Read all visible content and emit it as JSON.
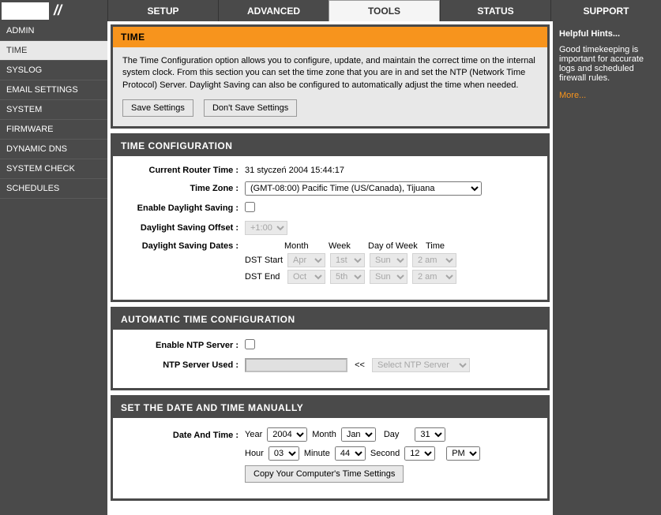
{
  "nav": {
    "setup": "SETUP",
    "advanced": "ADVANCED",
    "tools": "TOOLS",
    "status": "STATUS",
    "support": "SUPPORT"
  },
  "sidebar": {
    "admin": "ADMIN",
    "time": "TIME",
    "syslog": "SYSLOG",
    "email": "EMAIL SETTINGS",
    "system": "SYSTEM",
    "firmware": "FIRMWARE",
    "ddns": "DYNAMIC DNS",
    "syscheck": "SYSTEM CHECK",
    "schedules": "SCHEDULES"
  },
  "hints": {
    "title": "Helpful Hints...",
    "text": "Good timekeeping is important for accurate logs and scheduled firewall rules.",
    "more": "More..."
  },
  "time_panel": {
    "title": "TIME",
    "desc": "The Time Configuration option allows you to configure, update, and maintain the correct time on the internal system clock. From this section you can set the time zone that you are in and set the NTP (Network Time Protocol) Server. Daylight Saving can also be configured to automatically adjust the time when needed.",
    "save": "Save Settings",
    "dont": "Don't Save Settings"
  },
  "cfg": {
    "title": "TIME CONFIGURATION",
    "cur_label": "Current Router Time :",
    "cur_val": "31 styczeń 2004 15:44:17",
    "tz_label": "Time Zone :",
    "tz_val": "(GMT-08:00) Pacific Time (US/Canada), Tijuana",
    "dst_en_label": "Enable Daylight Saving :",
    "dst_off_label": "Daylight Saving Offset :",
    "dst_off_val": "+1:00",
    "dst_dates_label": "Daylight Saving Dates :",
    "col_month": "Month",
    "col_week": "Week",
    "col_dow": "Day of Week",
    "col_time": "Time",
    "dst_start": "DST Start",
    "dst_end": "DST End",
    "s_month": "Apr",
    "s_week": "1st",
    "s_dow": "Sun",
    "s_time": "2 am",
    "e_month": "Oct",
    "e_week": "5th",
    "e_dow": "Sun",
    "e_time": "2 am"
  },
  "ntp": {
    "title": "AUTOMATIC TIME CONFIGURATION",
    "en_label": "Enable NTP Server :",
    "used_label": "NTP Server Used :",
    "arrow": "<<",
    "select": "Select NTP Server"
  },
  "manual": {
    "title": "SET THE DATE AND TIME MANUALLY",
    "label": "Date And Time :",
    "year_l": "Year",
    "year": "2004",
    "month_l": "Month",
    "month": "Jan",
    "day_l": "Day",
    "day": "31",
    "hour_l": "Hour",
    "hour": "03",
    "min_l": "Minute",
    "min": "44",
    "sec_l": "Second",
    "sec": "12",
    "ampm": "PM",
    "copy": "Copy Your Computer's Time Settings"
  }
}
